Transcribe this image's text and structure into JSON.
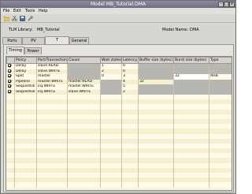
{
  "window": {
    "title": "Model MB_Tutorial.DMA",
    "controls": [
      "-",
      "□",
      "x"
    ]
  },
  "menu": [
    "File",
    "Edit",
    "Tools",
    "Help"
  ],
  "toolbar": {
    "icons": [
      "folder-icon",
      "cut-icon",
      "save-icon",
      "tools-icon"
    ]
  },
  "library": {
    "label": "TLM Library:",
    "value": "MB_Tutorial",
    "model_label": "Model Name:",
    "model_value": "DMA"
  },
  "top_tabs": [
    {
      "label": "Ports",
      "active": false
    },
    {
      "label": "PV",
      "active": false
    },
    {
      "label": "T",
      "active": true
    },
    {
      "label": "General",
      "active": false
    }
  ],
  "sub_tabs": [
    {
      "label": "Timing",
      "active": true
    },
    {
      "label": "Power",
      "active": false
    }
  ],
  "table": {
    "headers": [
      "",
      "Policy",
      "Port/Transaction",
      "Cause",
      "Wait states",
      "Latency",
      "Buffer size (bytes)",
      "Burst size (bytes)",
      "Type"
    ],
    "rows": [
      {
        "checked": true,
        "policy": "Delay",
        "port": "slave.READ",
        "cause": "",
        "wait": "1",
        "latency": "0",
        "buffer": "",
        "burst": "",
        "type": ""
      },
      {
        "checked": true,
        "policy": "Delay",
        "port": "slave.WRITE",
        "cause": "",
        "wait": "2",
        "latency": "0",
        "buffer": "",
        "burst": "",
        "type": ""
      },
      {
        "checked": true,
        "policy": "Split",
        "port": "master",
        "cause": "",
        "wait": "0",
        "latency": "3",
        "buffer": "",
        "burst": "32",
        "type": "AHB"
      },
      {
        "checked": true,
        "policy": "Pipeline",
        "port": "master.WRITE",
        "cause": "master.READ",
        "wait": "",
        "latency": "4",
        "buffer": "32",
        "burst": "",
        "type": ""
      },
      {
        "checked": true,
        "policy": "Sequential",
        "port": "irq.WRITE",
        "cause": "master.WRITE",
        "wait": "",
        "latency": "5",
        "buffer": "",
        "burst": "",
        "type": ""
      },
      {
        "checked": true,
        "policy": "Sequential",
        "port": "irq.WRITE",
        "cause": "slave.WRITE",
        "wait": "",
        "latency": "2",
        "buffer": "",
        "burst": "",
        "type": ""
      }
    ],
    "empty_rows": 19
  }
}
